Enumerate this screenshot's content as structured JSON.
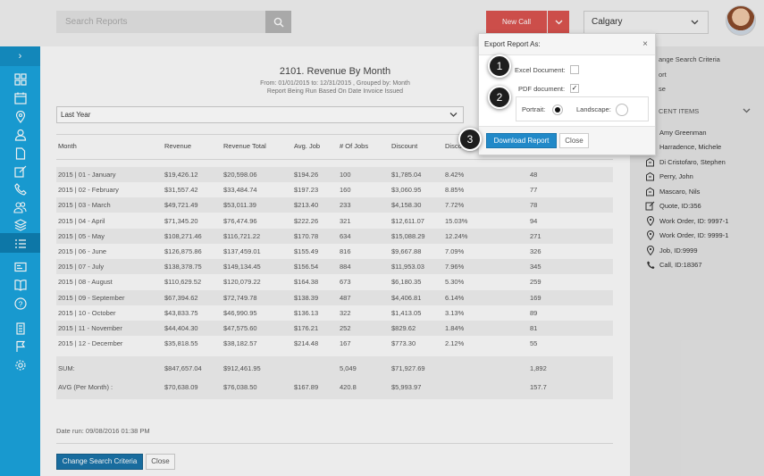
{
  "topbar": {
    "search_placeholder": "Search Reports",
    "new_call_label": "New Call",
    "location": "Calgary"
  },
  "colors": {
    "sidebar": "#1aa3dc",
    "new_call": "#d9534f",
    "primary_button": "#1a73a8"
  },
  "sidebar_icons": [
    "menu-toggle-icon",
    "dashboard-icon",
    "calendar-icon",
    "map-pin-icon",
    "customer-icon",
    "document-icon",
    "edit-icon",
    "phone-icon",
    "users-icon",
    "layers-icon",
    "reports-list-icon",
    "id-card-icon",
    "book-icon",
    "help-icon",
    "building-icon",
    "flag-icon",
    "settings-icon"
  ],
  "report": {
    "title": "2101. Revenue By Month",
    "subtitle1": "From: 01/01/2015 to: 12/31/2015 , Grouped by: Month",
    "subtitle2": "Report Being Run Based On Date Invoice Issued",
    "period": "Last Year",
    "columns": [
      "Month",
      "Revenue",
      "Revenue Total",
      "Avg. Job",
      "# Of Jobs",
      "Discount",
      "Disco",
      ""
    ],
    "rows": [
      [
        "2015 | 01 - January",
        "$19,426.12",
        "$20,598.06",
        "$194.26",
        "100",
        "$1,785.04",
        "8.42%",
        "48"
      ],
      [
        "2015 | 02 - February",
        "$31,557.42",
        "$33,484.74",
        "$197.23",
        "160",
        "$3,060.95",
        "8.85%",
        "77"
      ],
      [
        "2015 | 03 - March",
        "$49,721.49",
        "$53,011.39",
        "$213.40",
        "233",
        "$4,158.30",
        "7.72%",
        "78"
      ],
      [
        "2015 | 04 - April",
        "$71,345.20",
        "$76,474.96",
        "$222.26",
        "321",
        "$12,611.07",
        "15.03%",
        "94"
      ],
      [
        "2015 | 05 - May",
        "$108,271.46",
        "$116,721.22",
        "$170.78",
        "634",
        "$15,088.29",
        "12.24%",
        "271"
      ],
      [
        "2015 | 06 - June",
        "$126,875.86",
        "$137,459.01",
        "$155.49",
        "816",
        "$9,667.88",
        "7.09%",
        "326"
      ],
      [
        "2015 | 07 - July",
        "$138,378.75",
        "$149,134.45",
        "$156.54",
        "884",
        "$11,953.03",
        "7.96%",
        "345"
      ],
      [
        "2015 | 08 - August",
        "$110,629.52",
        "$120,079.22",
        "$164.38",
        "673",
        "$6,180.35",
        "5.30%",
        "259"
      ],
      [
        "2015 | 09 - September",
        "$67,394.62",
        "$72,749.78",
        "$138.39",
        "487",
        "$4,406.81",
        "6.14%",
        "169"
      ],
      [
        "2015 | 10 - October",
        "$43,833.75",
        "$46,990.95",
        "$136.13",
        "322",
        "$1,413.05",
        "3.13%",
        "89"
      ],
      [
        "2015 | 11 - November",
        "$44,404.30",
        "$47,575.60",
        "$176.21",
        "252",
        "$829.62",
        "1.84%",
        "81"
      ],
      [
        "2015 | 12 - December",
        "$35,818.55",
        "$38,182.57",
        "$214.48",
        "167",
        "$773.30",
        "2.12%",
        "55"
      ]
    ],
    "sum": [
      "SUM:",
      "$847,657.04",
      "$912,461.95",
      "",
      "5,049",
      "$71,927.69",
      "",
      "1,892"
    ],
    "avg": [
      "AVG (Per Month) :",
      "$70,638.09",
      "$76,038.50",
      "$167.89",
      "420.8",
      "$5,993.97",
      "",
      "157.7"
    ],
    "date_run": "Date run: 09/08/2016 01:38 PM",
    "change_criteria_label": "Change Search Criteria",
    "close_label": "Close"
  },
  "right_panel": {
    "links": [
      "ange Search Criteria",
      "ort",
      "se"
    ],
    "recent_heading": "CENT ITEMS",
    "recent_items": [
      {
        "icon": "user-icon",
        "label": "Amy Greenman"
      },
      {
        "icon": "user-icon",
        "label": "Harradence, Michele"
      },
      {
        "icon": "building-icon",
        "label": "Di Cristofaro, Stephen"
      },
      {
        "icon": "building-icon",
        "label": "Perry, John"
      },
      {
        "icon": "building-icon",
        "label": "Mascaro, Nils"
      },
      {
        "icon": "edit-icon",
        "label": "Quote, ID:356"
      },
      {
        "icon": "map-pin-icon",
        "label": "Work Order, ID: 9997-1"
      },
      {
        "icon": "map-pin-icon",
        "label": "Work Order, ID: 9999-1"
      },
      {
        "icon": "map-pin-icon",
        "label": "Job, ID:9999"
      },
      {
        "icon": "phone-icon",
        "label": "Call, ID:18367"
      }
    ]
  },
  "dialog": {
    "title": "Export Report As:",
    "excel_label": "Excel Document:",
    "excel_checked": false,
    "pdf_label": "PDF document:",
    "pdf_checked": true,
    "portrait_label": "Portrait:",
    "landscape_label": "Landscape:",
    "orientation": "Portrait",
    "download_label": "Download Report",
    "close_label": "Close",
    "close_icon": "×",
    "pdf_check_mark": "✓"
  },
  "steps": [
    "1",
    "2",
    "3"
  ]
}
